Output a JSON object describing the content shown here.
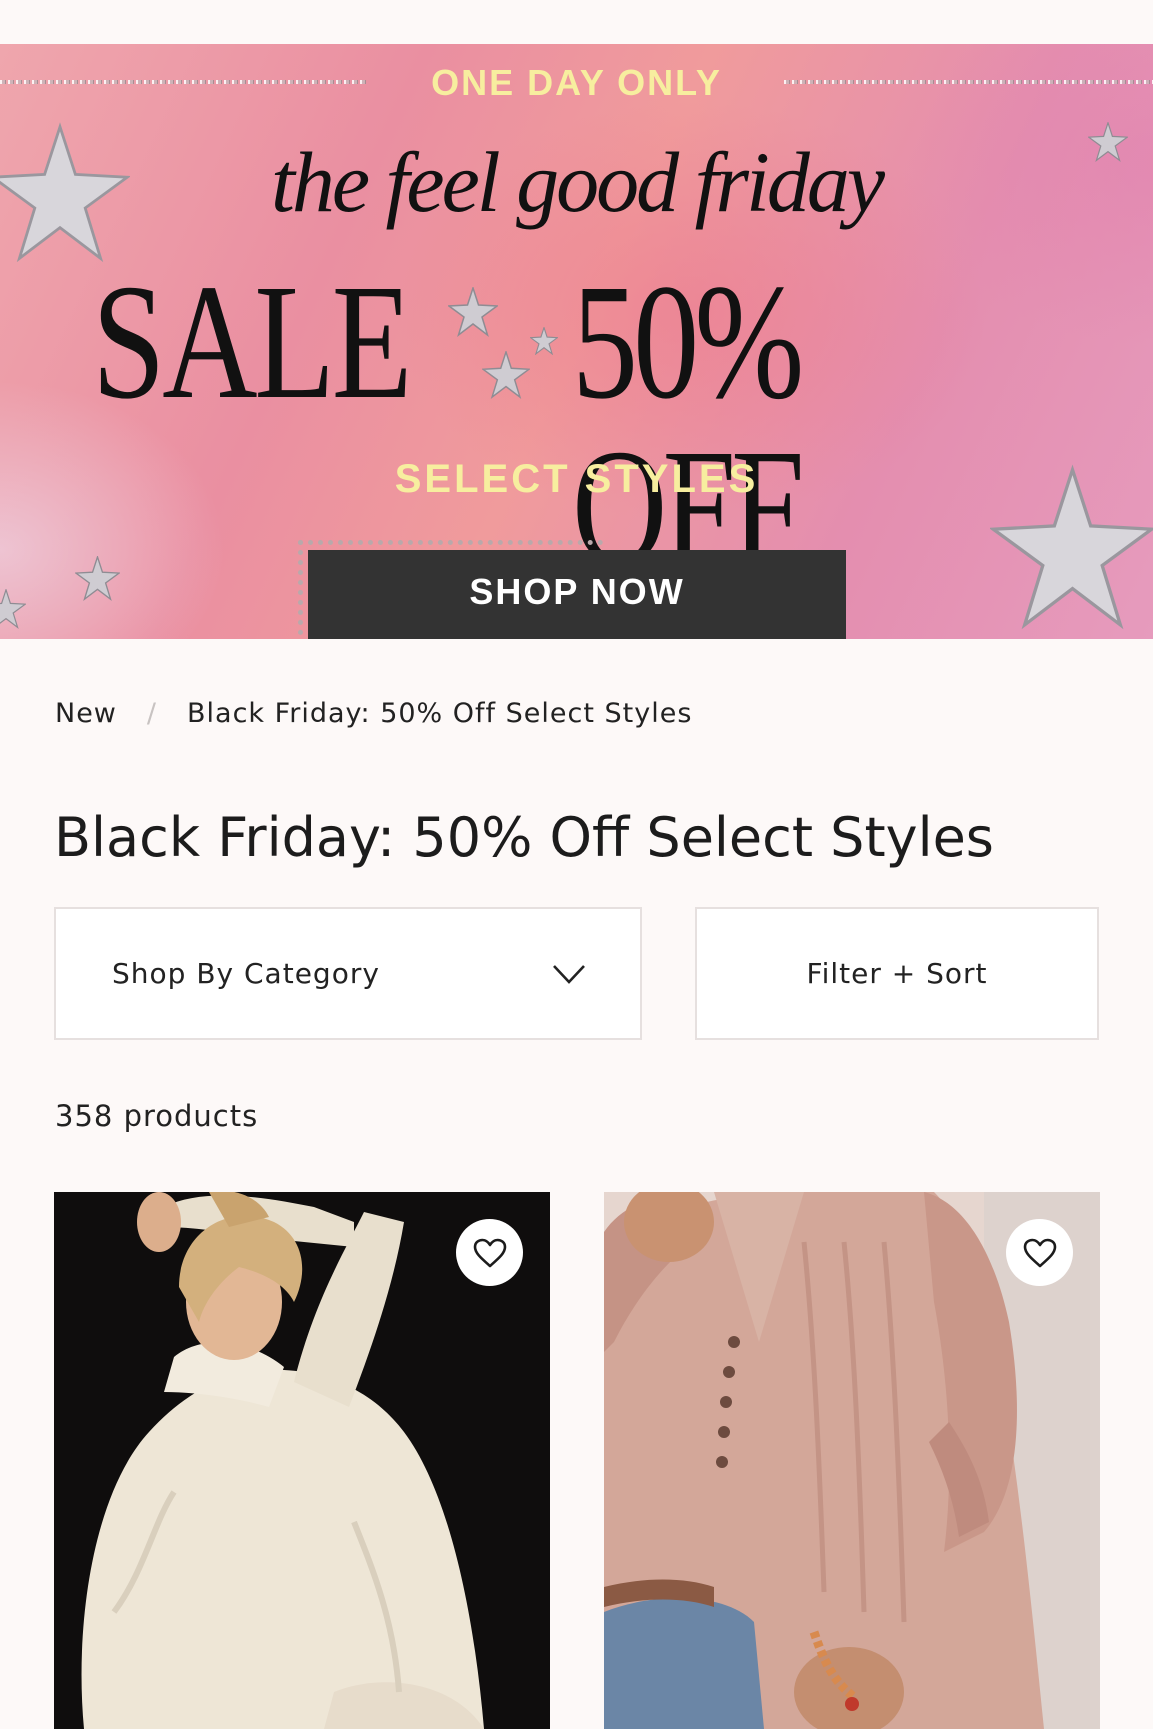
{
  "banner": {
    "kicker": "ONE DAY ONLY",
    "headline": "the feel good friday",
    "sale_word": "SALE",
    "discount": "50% OFF",
    "subline": "SELECT STYLES",
    "cta_label": "SHOP NOW",
    "colors": {
      "accent_text": "#f7ee9f",
      "cta_bg": "#333333"
    }
  },
  "breadcrumb": {
    "items": [
      "New",
      "Black Friday: 50% Off Select Styles"
    ],
    "separator": "/"
  },
  "page": {
    "title": "Black Friday: 50% Off Select Styles"
  },
  "controls": {
    "category_label": "Shop By Category",
    "category_icon": "chevron-down-icon",
    "filter_label": "Filter + Sort"
  },
  "results": {
    "count_text": "358 products"
  },
  "products": [
    {
      "image": "model-cream-turtleneck-sweater",
      "wishlist_icon": "heart-icon"
    },
    {
      "image": "model-pink-henley-top",
      "wishlist_icon": "heart-icon"
    }
  ]
}
